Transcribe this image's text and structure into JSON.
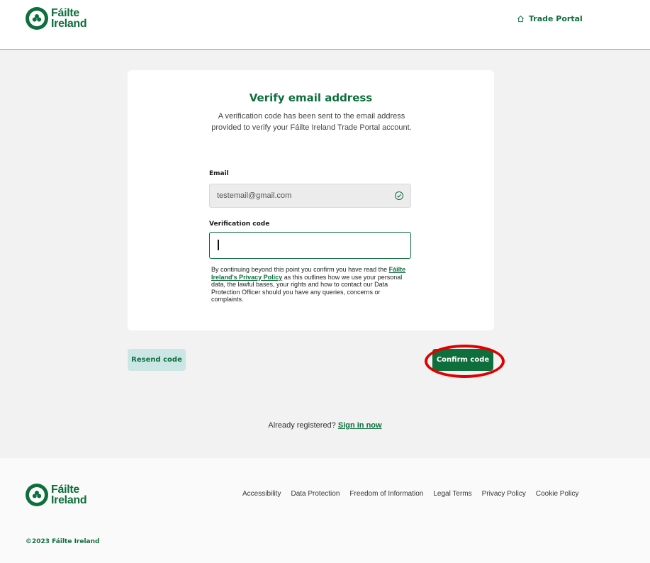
{
  "brand": {
    "name_line1": "Fáilte",
    "name_line2": "Ireland",
    "color": "#0e6e3c",
    "accent_line": "#8cc34a"
  },
  "header": {
    "trade_portal_label": "Trade Portal",
    "trade_portal_icon": "home-icon"
  },
  "card": {
    "title": "Verify email address",
    "description": "A verification code has been sent to the email address provided to verify your Fáilte Ireland Trade Portal account.",
    "email_label": "Email",
    "email_value": "testemail@gmail.com",
    "email_status_icon": "check-circle-icon",
    "code_label": "Verification code",
    "code_value": "",
    "privacy_pre": "By continuing beyond this point you confirm you have read the ",
    "privacy_link": "Fáilte Ireland's Privacy Policy",
    "privacy_post": " as this outlines how we use your personal data, the lawful bases, your rights and how to contact our Data Protection Officer should you have any queries, concerns or complaints."
  },
  "actions": {
    "resend_label": "Resend code",
    "confirm_label": "Confirm code",
    "highlight_color": "#e00000"
  },
  "signin": {
    "prompt": "Already registered? ",
    "link": "Sign in now"
  },
  "footer": {
    "links": [
      "Accessibility",
      "Data Protection",
      "Freedom of Information",
      "Legal Terms",
      "Privacy Policy",
      "Cookie Policy"
    ],
    "copyright": "©2023 Fáilte Ireland"
  }
}
